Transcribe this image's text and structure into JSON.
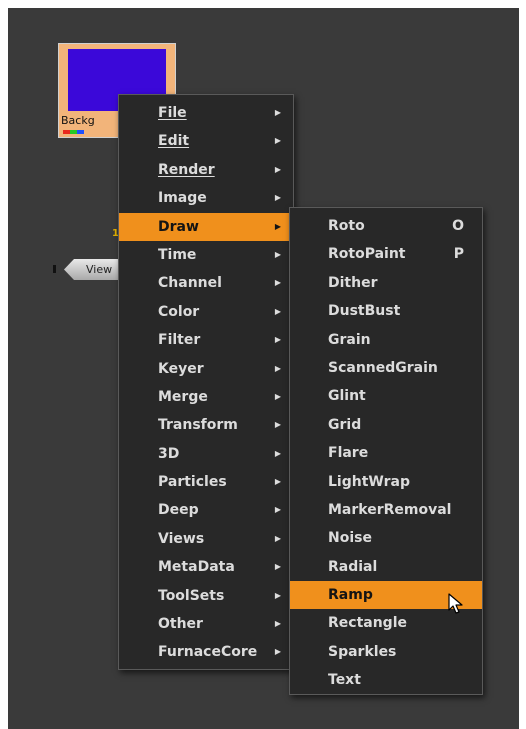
{
  "node": {
    "label": "Backg",
    "thumbnail_color": "#3b08d9",
    "channel_colors": [
      "#e8281e",
      "#26c826",
      "#1e50ff"
    ]
  },
  "viewer_node": {
    "label": "View"
  },
  "pipe_marker": "1",
  "main_menu": {
    "items": [
      {
        "label": "File",
        "submenu": true,
        "underline": true
      },
      {
        "label": "Edit",
        "submenu": true,
        "underline": true
      },
      {
        "label": "Render",
        "submenu": true,
        "underline": true
      },
      {
        "label": "Image",
        "submenu": true
      },
      {
        "label": "Draw",
        "submenu": true,
        "highlighted": true
      },
      {
        "label": "Time",
        "submenu": true
      },
      {
        "label": "Channel",
        "submenu": true
      },
      {
        "label": "Color",
        "submenu": true
      },
      {
        "label": "Filter",
        "submenu": true
      },
      {
        "label": "Keyer",
        "submenu": true
      },
      {
        "label": "Merge",
        "submenu": true
      },
      {
        "label": "Transform",
        "submenu": true
      },
      {
        "label": "3D",
        "submenu": true
      },
      {
        "label": "Particles",
        "submenu": true
      },
      {
        "label": "Deep",
        "submenu": true
      },
      {
        "label": "Views",
        "submenu": true
      },
      {
        "label": "MetaData",
        "submenu": true
      },
      {
        "label": "ToolSets",
        "submenu": true
      },
      {
        "label": "Other",
        "submenu": true
      },
      {
        "label": "FurnaceCore",
        "submenu": true
      }
    ]
  },
  "draw_submenu": {
    "items": [
      {
        "label": "Roto",
        "shortcut": "O"
      },
      {
        "label": "RotoPaint",
        "shortcut": "P"
      },
      {
        "label": "Dither"
      },
      {
        "label": "DustBust"
      },
      {
        "label": "Grain"
      },
      {
        "label": "ScannedGrain"
      },
      {
        "label": "Glint"
      },
      {
        "label": "Grid"
      },
      {
        "label": "Flare"
      },
      {
        "label": "LightWrap"
      },
      {
        "label": "MarkerRemoval"
      },
      {
        "label": "Noise"
      },
      {
        "label": "Radial"
      },
      {
        "label": "Ramp",
        "highlighted": true
      },
      {
        "label": "Rectangle"
      },
      {
        "label": "Sparkles"
      },
      {
        "label": "Text"
      }
    ]
  },
  "colors": {
    "highlight": "#f0901c",
    "menu_bg": "#282828",
    "canvas_bg": "#3a3a3a",
    "node_bg": "#f2b47a"
  },
  "icons": {
    "submenu_arrow": "triangle-right",
    "cursor": "mouse-pointer"
  }
}
